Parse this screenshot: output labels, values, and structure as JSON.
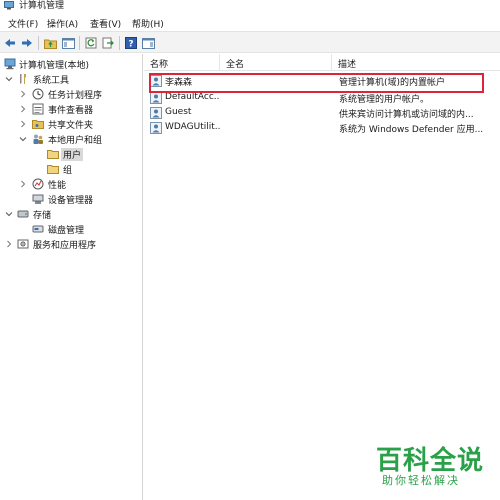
{
  "window": {
    "title": "计算机管理"
  },
  "menu": [
    {
      "label": "文件(F)"
    },
    {
      "label": "操作(A)"
    },
    {
      "label": "查看(V)"
    },
    {
      "label": "帮助(H)"
    }
  ],
  "toolbar": {
    "icons": [
      "back-arrow-icon",
      "forward-arrow-icon",
      "up-folder-icon",
      "show-hide-tree-icon",
      "refresh-icon",
      "export-list-icon",
      "help-icon",
      "properties-icon"
    ]
  },
  "tree": {
    "root": "计算机管理(本地)",
    "system_tools": "系统工具",
    "task_scheduler": "任务计划程序",
    "event_viewer": "事件查看器",
    "shared_folders": "共享文件夹",
    "local_users_groups": "本地用户和组",
    "users": "用户",
    "groups": "组",
    "performance": "性能",
    "device_manager": "设备管理器",
    "storage": "存储",
    "disk_management": "磁盘管理",
    "services_apps": "服务和应用程序",
    "selected": "users"
  },
  "list": {
    "columns": {
      "name": "名称",
      "fullname": "全名",
      "description": "描述"
    },
    "rows": [
      {
        "name": "李森森",
        "fullname": "",
        "description": "管理计算机(域)的内置帐户"
      },
      {
        "name": "DefaultAcc...",
        "fullname": "",
        "description": "系统管理的用户帐户。"
      },
      {
        "name": "Guest",
        "fullname": "",
        "description": "供来宾访问计算机或访问域的内..."
      },
      {
        "name": "WDAGUtilit...",
        "fullname": "",
        "description": "系统为 Windows Defender 应用..."
      }
    ],
    "highlighted_row": 0,
    "highlight_color": "#d9263a"
  },
  "watermark": {
    "line1": "百科全说",
    "line2": "助你轻松解决",
    "color": "#2aa149"
  }
}
